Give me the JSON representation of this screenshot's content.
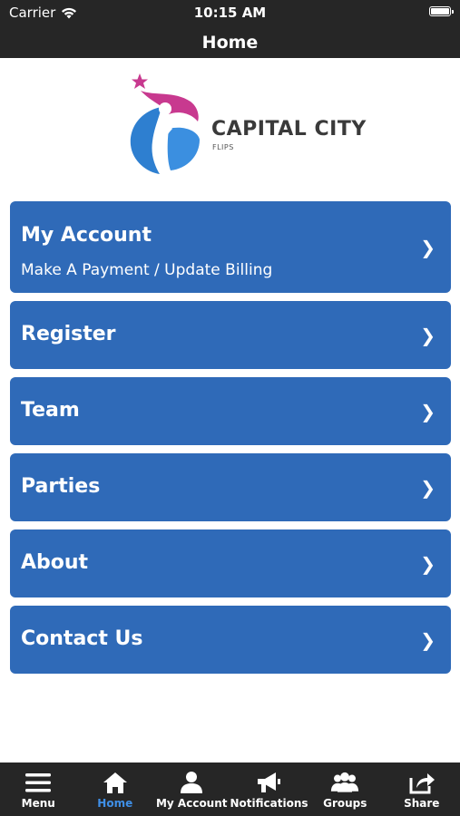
{
  "status": {
    "carrier": "Carrier",
    "time": "10:15 AM"
  },
  "header": {
    "title": "Home"
  },
  "logo": {
    "name": "CAPITAL CITY",
    "sub": "FLIPS",
    "colors": {
      "pink": "#c8398f",
      "blue": "#2e7fd0",
      "dark": "#3a3a3a"
    }
  },
  "menu": {
    "items": [
      {
        "label": "My Account",
        "sub": "Make A Payment / Update Billing"
      },
      {
        "label": "Register"
      },
      {
        "label": "Team"
      },
      {
        "label": "Parties"
      },
      {
        "label": "About"
      },
      {
        "label": "Contact Us"
      }
    ],
    "chevron": "❯",
    "color": "#2f6ab8"
  },
  "tabbar": {
    "tabs": [
      {
        "label": "Menu",
        "icon": "hamburger-icon",
        "active": false
      },
      {
        "label": "Home",
        "icon": "home-icon",
        "active": true
      },
      {
        "label": "My Account",
        "icon": "person-icon",
        "active": false
      },
      {
        "label": "Notifications",
        "icon": "megaphone-icon",
        "active": false
      },
      {
        "label": "Groups",
        "icon": "group-icon",
        "active": false
      },
      {
        "label": "Share",
        "icon": "share-icon",
        "active": false
      }
    ],
    "active_color": "#3f8fe6"
  }
}
